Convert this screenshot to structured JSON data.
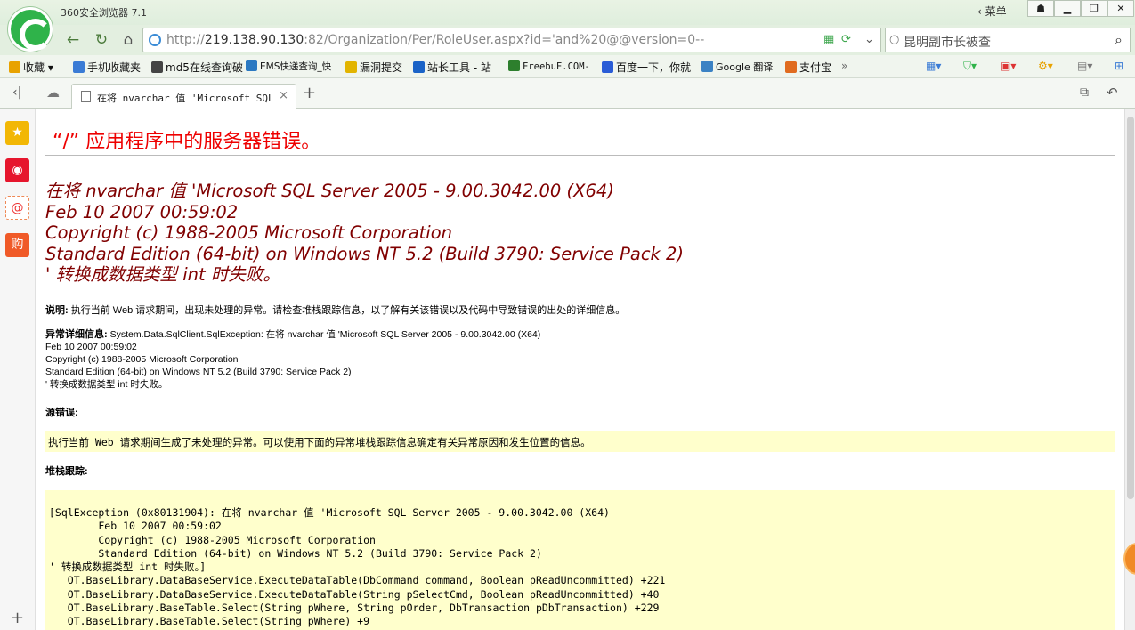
{
  "window": {
    "app_title": "360安全浏览器 7.1",
    "menu_label": "菜单"
  },
  "nav": {
    "url_gray_prefix": "http://",
    "url_host": "219.138.90.130",
    "url_rest": ":82/Organization/Per/RoleUser.aspx?id='and%20@@version=0--",
    "search_value": "昆明副市长被查"
  },
  "bookmarks": [
    {
      "label": "收藏",
      "color": "#e8a200"
    },
    {
      "label": "手机收藏夹",
      "color": "#3a7bd5"
    },
    {
      "label": "md5在线查询破",
      "color": "#444"
    },
    {
      "label": "EMS快递查询_快",
      "color": "#2b79c2"
    },
    {
      "label": "漏洞提交",
      "color": "#e2b400"
    },
    {
      "label": "站长工具 - 站",
      "color": "#1a63c7"
    },
    {
      "label": "FreebuF.COM-",
      "color": "#2d7f2d"
    },
    {
      "label": "百度一下，你就",
      "color": "#2a5cd6"
    },
    {
      "label": "Google 翻译",
      "color": "#3b82c4"
    },
    {
      "label": "支付宝",
      "color": "#e06b1f"
    }
  ],
  "tab": {
    "title": "在将 nvarchar 值 'Microsoft SQL Se",
    "close": "×",
    "new_tab": "+"
  },
  "page": {
    "title": "“/” 应用程序中的服务器错误。",
    "error_lines": [
      "在将 nvarchar 值 'Microsoft SQL Server 2005 - 9.00.3042.00 (X64)",
      "Feb 10 2007 00:59:02",
      "Copyright (c) 1988-2005 Microsoft Corporation",
      "Standard Edition (64-bit) on Windows NT 5.2 (Build 3790: Service Pack 2)",
      "' 转换成数据类型 int 时失败。"
    ],
    "desc_label": "说明:",
    "desc_text": " 执行当前 Web 请求期间，出现未处理的异常。请检查堆栈跟踪信息，以了解有关该错误以及代码中导致错误的出处的详细信息。",
    "exception_label": "异常详细信息:",
    "exception_lines": [
      " System.Data.SqlClient.SqlException: 在将  nvarchar 值 'Microsoft SQL Server 2005 - 9.00.3042.00 (X64)",
      "Feb 10 2007 00:59:02",
      "Copyright (c) 1988-2005 Microsoft Corporation",
      "Standard Edition (64-bit) on Windows NT 5.2 (Build 3790: Service Pack 2)",
      "' 转换成数据类型  int 时失败。"
    ],
    "source_label": "源错误:",
    "source_text": "执行当前 Web 请求期间生成了未处理的异常。可以使用下面的异常堆栈跟踪信息确定有关异常原因和发生位置的信息。",
    "stack_label": "堆栈跟踪:",
    "stack_lines": [
      "[SqlException (0x80131904): 在将 nvarchar 值 'Microsoft SQL Server 2005 - 9.00.3042.00 (X64)",
      "        Feb 10 2007 00:59:02",
      "        Copyright (c) 1988-2005 Microsoft Corporation",
      "        Standard Edition (64-bit) on Windows NT 5.2 (Build 3790: Service Pack 2)",
      "' 转换成数据类型 int 时失败。]",
      "   OT.BaseLibrary.DataBaseService.ExecuteDataTable(DbCommand command, Boolean pReadUncommitted) +221",
      "   OT.BaseLibrary.DataBaseService.ExecuteDataTable(String pSelectCmd, Boolean pReadUncommitted) +40",
      "   OT.BaseLibrary.BaseTable.Select(String pWhere, String pOrder, DbTransaction pDbTransaction) +229",
      "   OT.BaseLibrary.BaseTable.Select(String pWhere) +9"
    ]
  },
  "colors": {
    "error_red": "#e00000",
    "error_maroon": "#800000",
    "highlight_yellow": "#ffffcc"
  }
}
